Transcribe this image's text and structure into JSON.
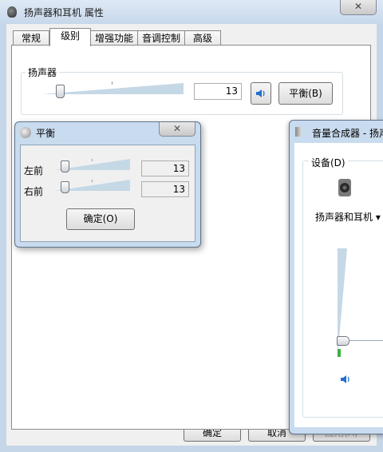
{
  "main_window": {
    "title": "扬声器和耳机 属性",
    "close_glyph": "✕",
    "tabs": [
      {
        "label": "常规"
      },
      {
        "label": "级别"
      },
      {
        "label": "增强功能"
      },
      {
        "label": "音调控制"
      },
      {
        "label": "高级"
      }
    ],
    "active_tab": "级别",
    "speaker_group": {
      "label": "扬声器",
      "level": 13,
      "level_text": "13",
      "mute_icon": "speaker-icon",
      "balance_button": "平衡(B)"
    },
    "buttons": {
      "ok": "确定",
      "cancel": "取消",
      "apply": "应用(A)"
    }
  },
  "balance_dialog": {
    "title": "平衡",
    "close_glyph": "✕",
    "channels": [
      {
        "label": "左前",
        "value": 13,
        "value_text": "13"
      },
      {
        "label": "右前",
        "value": 13,
        "value_text": "13"
      }
    ],
    "ok_button": "确定(O)"
  },
  "mixer_window": {
    "title": "音量合成器 - 扬声",
    "device_group_label": "设备(D)",
    "device_name": "扬声器和耳机 ▾",
    "device_icon": "speaker-device-icon",
    "mute_icon": "speaker-icon",
    "volume": 13
  },
  "colors": {
    "titlebar": "#c9dbee",
    "track": "#c5d8e6",
    "accent_blue": "#1f6fd1"
  }
}
